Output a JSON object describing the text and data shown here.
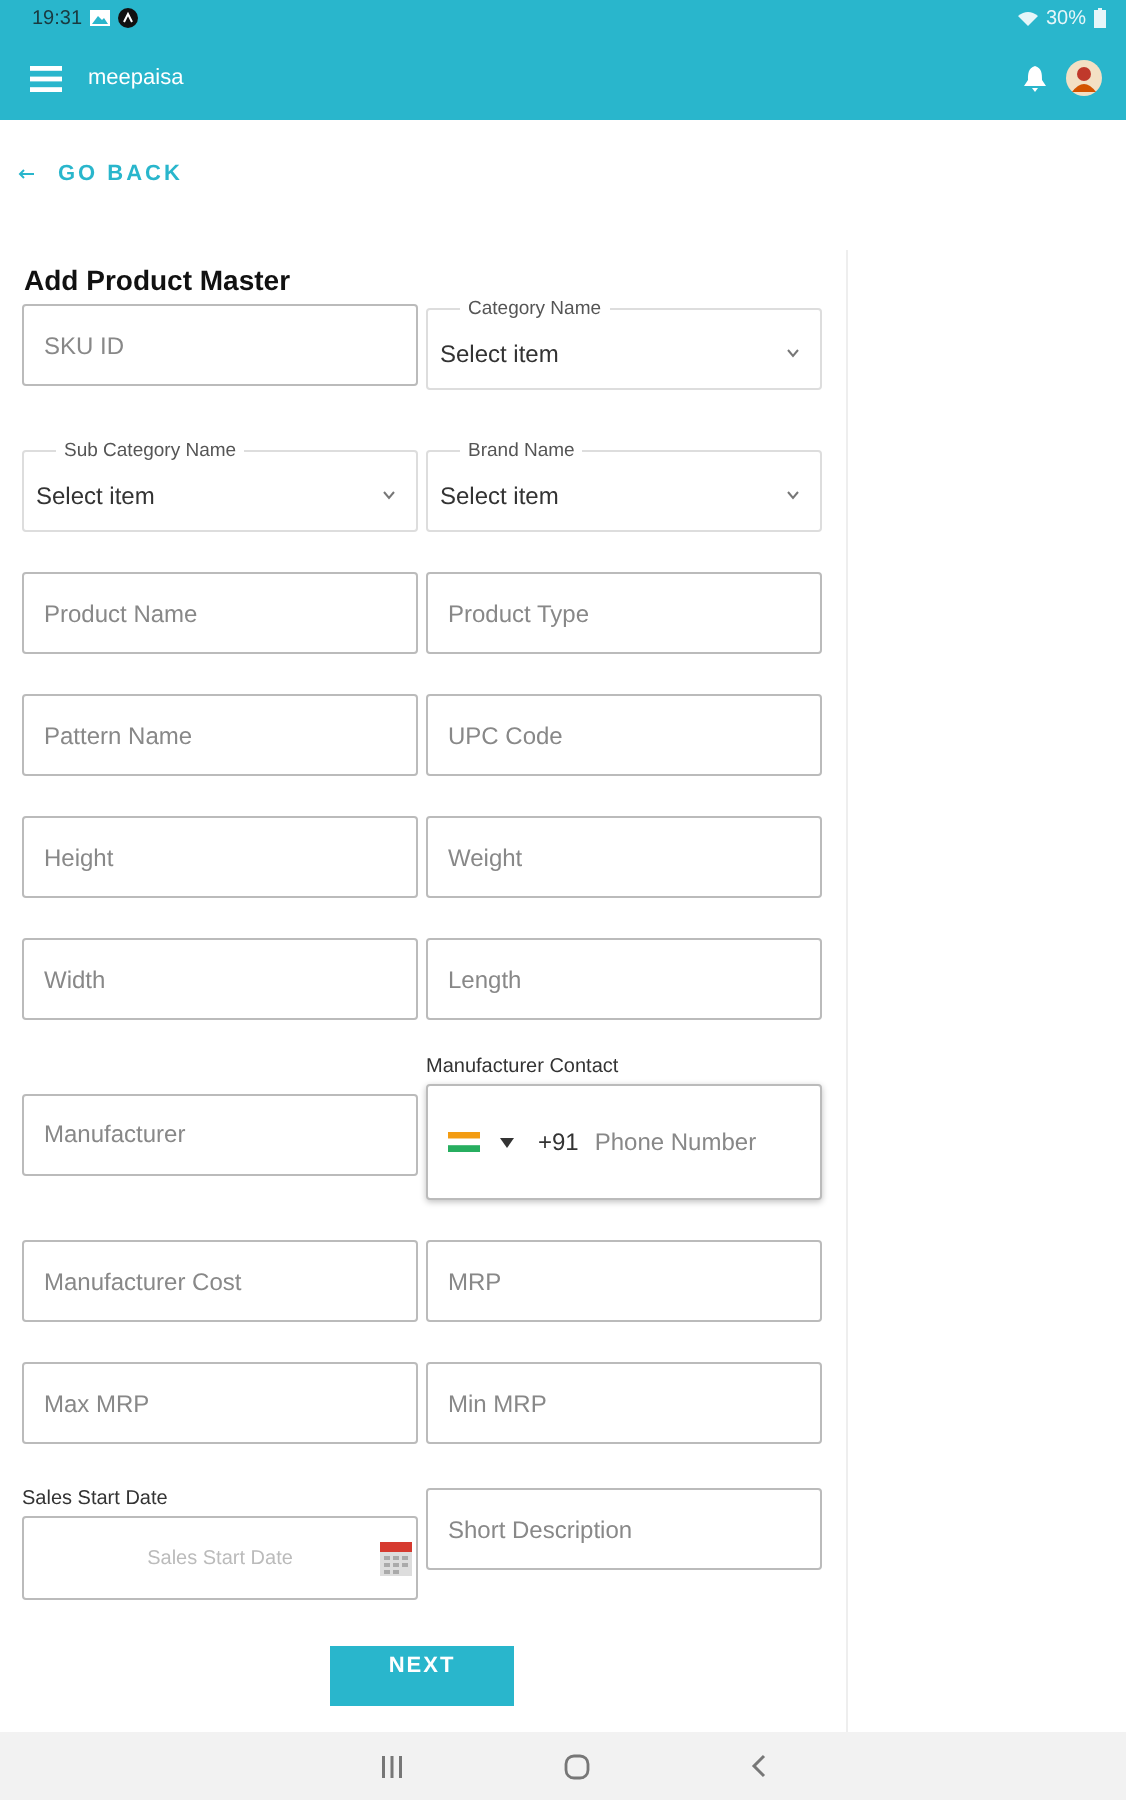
{
  "status_bar": {
    "time": "19:31",
    "battery": "30%"
  },
  "app_bar": {
    "title": "meepaisa"
  },
  "back_link": {
    "label": "GO BACK"
  },
  "form": {
    "title": "Add Product Master",
    "rows": [
      [
        {
          "kind": "input",
          "placeholder": "SKU ID"
        },
        {
          "kind": "select",
          "label": "Category Name",
          "value": "Select item"
        }
      ],
      [
        {
          "kind": "select",
          "label": "Sub Category Name",
          "value": "Select item"
        },
        {
          "kind": "select",
          "label": "Brand Name",
          "value": "Select item"
        }
      ],
      [
        {
          "kind": "input",
          "placeholder": "Product Name"
        },
        {
          "kind": "input",
          "placeholder": "Product Type"
        }
      ],
      [
        {
          "kind": "input",
          "placeholder": "Pattern Name"
        },
        {
          "kind": "input",
          "placeholder": "UPC Code"
        }
      ],
      [
        {
          "kind": "input",
          "placeholder": "Height"
        },
        {
          "kind": "input",
          "placeholder": "Weight"
        }
      ],
      [
        {
          "kind": "input",
          "placeholder": "Width"
        },
        {
          "kind": "input",
          "placeholder": "Length"
        }
      ],
      [
        {
          "kind": "input",
          "placeholder": "Manufacturer"
        },
        {
          "kind": "phone",
          "label": "Manufacturer Contact",
          "code": "+91",
          "placeholder": "Phone Number"
        }
      ],
      [
        {
          "kind": "input",
          "placeholder": "Manufacturer Cost"
        },
        {
          "kind": "input",
          "placeholder": "MRP"
        }
      ],
      [
        {
          "kind": "input",
          "placeholder": "Max MRP"
        },
        {
          "kind": "input",
          "placeholder": "Min MRP"
        }
      ],
      [
        {
          "kind": "date",
          "label": "Sales Start Date",
          "placeholder": "Sales Start Date"
        },
        {
          "kind": "input",
          "placeholder": "Short Description"
        }
      ]
    ],
    "submit": "NEXT"
  }
}
